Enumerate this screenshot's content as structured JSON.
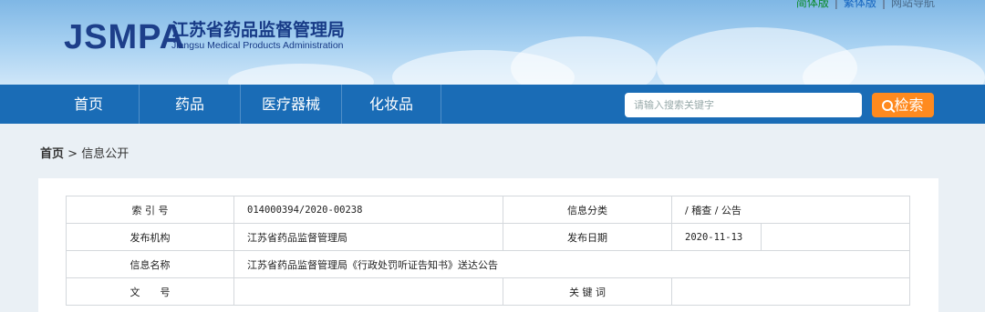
{
  "header": {
    "logo": "JSMPA",
    "title_cn": "江苏省药品监督管理局",
    "title_en": "Jiangsu Medical Products Administration",
    "lang_links": [
      "简体版",
      "繁体版",
      "网站导航"
    ]
  },
  "nav": {
    "items": [
      "首页",
      "药品",
      "医疗器械",
      "化妆品"
    ],
    "search_placeholder": "请输入搜索关键字",
    "search_button": "检索"
  },
  "breadcrumb": {
    "home": "首页",
    "sep": ">",
    "current": "信息公开"
  },
  "info_table": {
    "index_label": "索 引 号",
    "index_value": "014000394/2020-00238",
    "category_label": "信息分类",
    "category_value": "/ 稽查 / 公告",
    "org_label": "发布机构",
    "org_value": "江苏省药品监督管理局",
    "date_label": "发布日期",
    "date_value": "2020-11-13",
    "name_label": "信息名称",
    "name_value": "江苏省药品监督管理局《行政处罚听证告知书》送达公告",
    "doc_label": "文　　号",
    "doc_value": "",
    "keyword_label": "关 键 词",
    "keyword_value": ""
  }
}
